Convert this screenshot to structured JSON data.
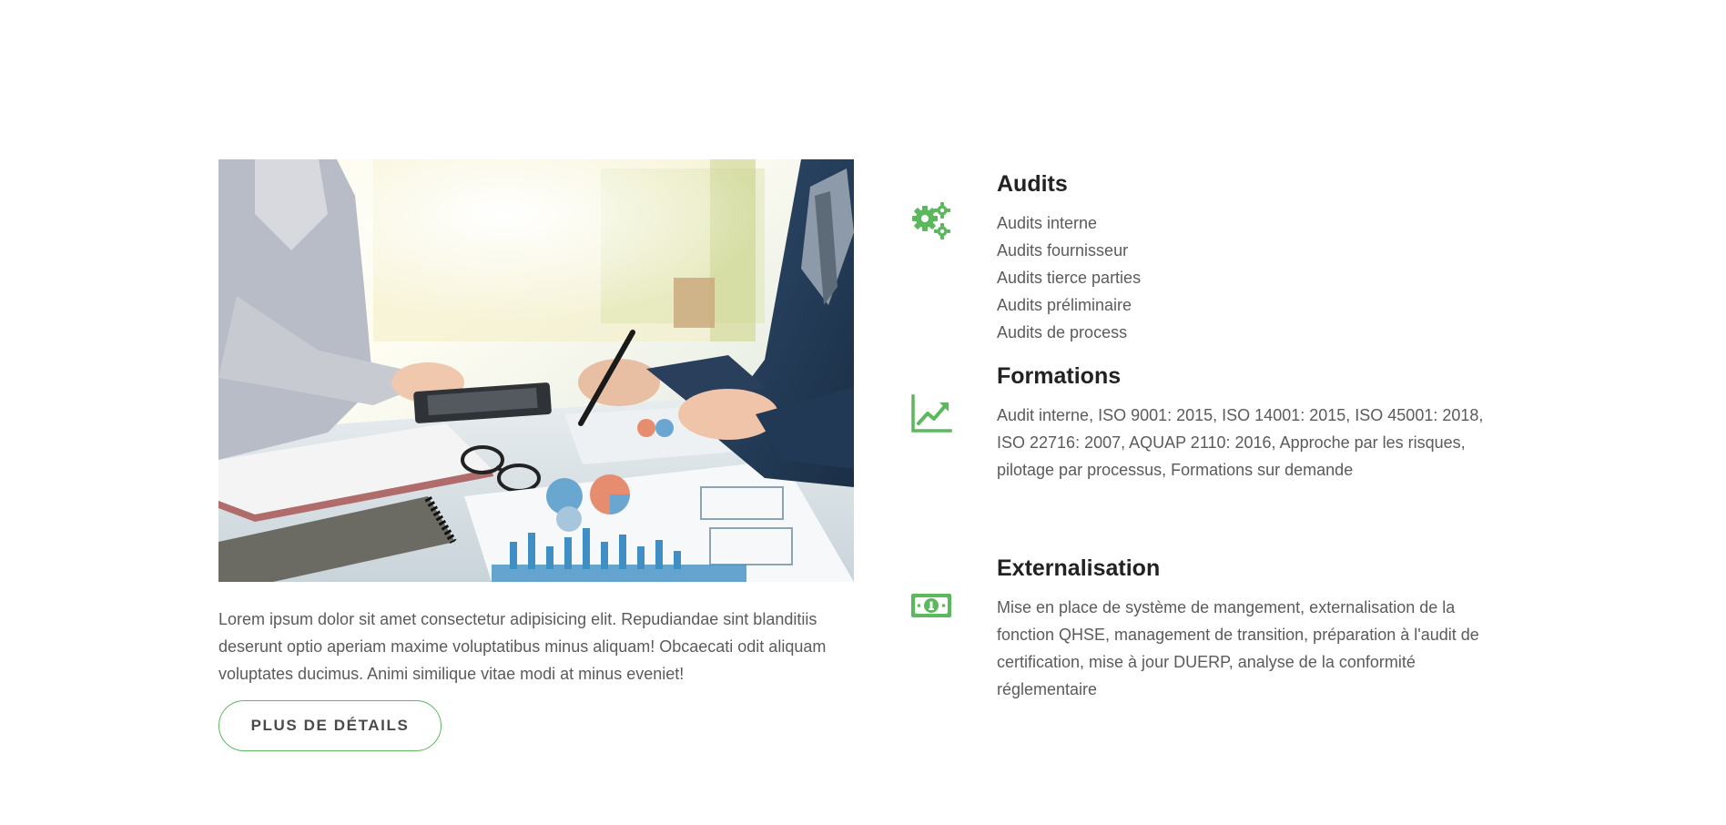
{
  "intro": {
    "text": "Lorem ipsum dolor sit amet consectetur adipisicing elit. Repudiandae sint blanditiis deserunt optio aperiam maxime voluptatibus minus aliquam! Obcaecati odit aliquam voluptates ducimus. Animi similique vitae modi at minus eveniet!",
    "button_label": "PLUS DE DÉTAILS"
  },
  "colors": {
    "accent": "#5cb85c",
    "heading": "#222222",
    "body_text": "#5b5b5b"
  },
  "features": [
    {
      "icon": "gears-icon",
      "title": "Audits",
      "items": [
        "Audits interne",
        "Audits fournisseur",
        "Audits tierce parties",
        "Audits préliminaire",
        "Audits de process"
      ]
    },
    {
      "icon": "chart-line-icon",
      "title": "Formations",
      "description": "Audit interne, ISO 9001: 2015, ISO 14001: 2015, ISO 45001: 2018, ISO 22716: 2007, AQUAP 2110: 2016, Approche par les risques, pilotage par processus, Formations sur demande"
    },
    {
      "icon": "money-bill-icon",
      "title": "Externalisation",
      "description": "Mise en place de système de mangement, externalisation de la fonction QHSE, management de transition, préparation à l'audit de certification, mise à jour DUERP, analyse de la conformité réglementaire"
    }
  ]
}
